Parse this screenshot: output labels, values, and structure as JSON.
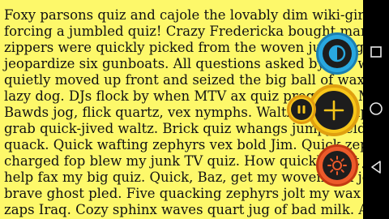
{
  "document": {
    "lines": [
      "Foxy parsons quiz and cajole the lovably dim wiki-girl!",
      "forcing a jumbled quiz! Crazy Fredericka bought many very",
      "zippers were quickly picked from the woven jute bag. Six",
      "jeopardize six gunboats. All questions asked by five watch",
      "quietly moved up front and seized the big ball of wax. The",
      "lazy dog. DJs flock by when MTV ax quiz prog. Junk MTV",
      "Bawds jog, flick quartz, vex nymphs. Waltz, bad nymph, for",
      "grab quick-jived waltz. Brick quiz whangs jumpy veldt fox.",
      "quack. Quick wafting zephyrs vex bold Jim. Quick zephyrs",
      "charged fop blew my junk TV quiz. How quickly daft jumping",
      "help fax my big quiz. Quick, Baz, get my woven flax jodhpurs",
      "brave ghost pled. Five quacking zephyrs jolt my wax bed.",
      "zaps Iraq. Cozy sphinx waves quart jug of bad milk. A very"
    ]
  },
  "floating_controls": {
    "contrast": "contrast-icon",
    "pause": "pause-icon",
    "add": "plus-icon",
    "brightness": "brightness-icon",
    "colors": {
      "contrast_ring": "#29a8e0",
      "pause_ring": "#f7c61a",
      "add_ring": "#f7c61a",
      "brightness_ring": "#ec5a2a"
    }
  },
  "navigation_bar": {
    "recents": "square-icon",
    "home": "circle-icon",
    "back": "triangle-back-icon"
  },
  "theme": {
    "page_background": "#fdf86a",
    "text_color": "#111111"
  }
}
